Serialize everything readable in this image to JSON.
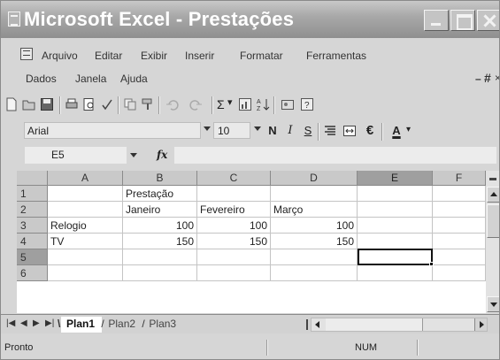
{
  "window": {
    "title": "Microsoft Excel - Prestações"
  },
  "menu": {
    "row1": [
      "Arquivo",
      "Editar",
      "Exibir",
      "Inserir",
      "Formatar",
      "Ferramentas"
    ],
    "row2": [
      "Dados",
      "Janela",
      "Ajuda"
    ]
  },
  "toolbar_std": {
    "icons": [
      "new-icon",
      "open-icon",
      "save-icon",
      "print-icon",
      "print-preview-icon",
      "spelling-icon",
      "copy-icon",
      "format-painter-icon",
      "undo-icon",
      "redo-icon",
      "autosum-icon",
      "chart-wizard-icon",
      "sort-ascending-icon",
      "drawing-icon",
      "help-icon"
    ],
    "autosum_label": "Σ"
  },
  "format_bar": {
    "font_name": "Arial",
    "font_size": "10",
    "bold": "N",
    "italic": "I",
    "underline": "S",
    "currency": "€",
    "font_color": "A"
  },
  "formula_bar": {
    "name_box": "E5",
    "fx": "fx",
    "formula": ""
  },
  "sheet": {
    "columns": [
      "A",
      "B",
      "C",
      "D",
      "E",
      "F"
    ],
    "selected_column": "E",
    "rows": [
      {
        "num": "1",
        "cells": [
          "",
          "Prestação",
          "",
          "",
          "",
          ""
        ]
      },
      {
        "num": "2",
        "cells": [
          "",
          "Janeiro",
          "Fevereiro",
          "Março",
          "",
          ""
        ]
      },
      {
        "num": "3",
        "cells": [
          "Relogio",
          "100",
          "100",
          "100",
          "",
          ""
        ]
      },
      {
        "num": "4",
        "cells": [
          "TV",
          "150",
          "150",
          "150",
          "",
          ""
        ]
      },
      {
        "num": "5",
        "cells": [
          "",
          "",
          "",
          "",
          "",
          ""
        ]
      },
      {
        "num": "6",
        "cells": [
          "",
          "",
          "",
          "",
          "",
          ""
        ]
      }
    ],
    "selected_row": "5",
    "active_cell": "E5"
  },
  "tabs": [
    "Plan1",
    "Plan2",
    "Plan3"
  ],
  "active_tab": "Plan1",
  "status": {
    "text": "Pronto",
    "num": "NUM"
  }
}
